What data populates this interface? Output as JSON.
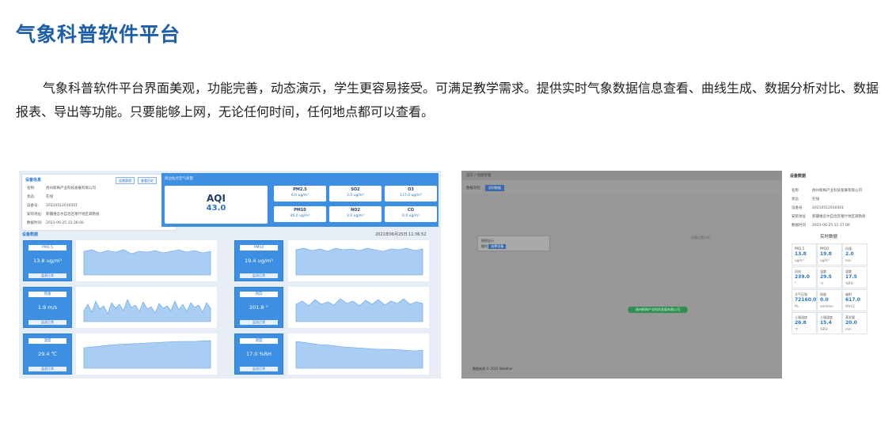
{
  "page": {
    "title": "气象科普软件平台",
    "intro": "气象科普软件平台界面美观，功能完善，动态演示，学生更容易接受。可满足教学需求。提供实时气象数据信息查看、曲线生成、数据分析对比、数据报表、导出等功能。只要能够上网，无论任何时间，任何地点都可以查看。"
  },
  "left_shot": {
    "device": {
      "header": "设备信息",
      "btn_manage": "运维管理",
      "btn_history": "查看历史",
      "rows": [
        {
          "k": "名称:",
          "v": "扬州新梅产业科技发展有限公司"
        },
        {
          "k": "状态:",
          "v": "在线"
        },
        {
          "k": "设备号:",
          "v": "20210512010301"
        },
        {
          "k": "安装地址:",
          "v": "新疆维吾尔自治区喀什地区疏勒县"
        },
        {
          "k": "数据时间:",
          "v": "2021-06-25 11:36:00"
        }
      ]
    },
    "aqi": {
      "header": "周边站点空气质量",
      "label": "AQI",
      "value": "43.0",
      "pollutants": [
        {
          "name": "PM2.5",
          "value": "6.0 ug/m³"
        },
        {
          "name": "SO2",
          "value": "3.0 ug/m³"
        },
        {
          "name": "O3",
          "value": "137.0 ug/m³"
        },
        {
          "name": "PM10",
          "value": "40.0 ug/m³"
        },
        {
          "name": "NO2",
          "value": "3.0 ug/m³"
        },
        {
          "name": "CO",
          "value": "0.4 ug/m³"
        }
      ]
    },
    "monitor": {
      "header": "设备数据",
      "datetime": "2021年06月25日 11:36:52",
      "status_label": "监测正常",
      "cards": [
        {
          "name": "PM2.5",
          "value": "13.8 ug/m³"
        },
        {
          "name": "PM10",
          "value": "19.4 ug/m³"
        },
        {
          "name": "风速",
          "value": "1.9 m/s"
        },
        {
          "name": "风向",
          "value": "201.8 °"
        },
        {
          "name": "温度",
          "value": "29.4 ℃"
        },
        {
          "name": "湿度",
          "value": "17.0 %RH"
        }
      ]
    }
  },
  "right_shot": {
    "topbar": "首页 / 地图管理",
    "tab_label": "数据对比",
    "tab_active": "实时数据",
    "legend_a": "图例显示",
    "legend_b": "操作",
    "legend_btn": "选择设备",
    "map_label": "设备位置分布",
    "green_button": "扬州新梅产业科技发展有限公司",
    "footnote": "数据来源 © 2021 Weather",
    "panel": {
      "header": "设备数据",
      "rows": [
        {
          "k": "名称",
          "v": "扬州新梅产业科技发展有限公司"
        },
        {
          "k": "状态",
          "v": "在线"
        },
        {
          "k": "设备号",
          "v": "20210512010301"
        },
        {
          "k": "安装地址",
          "v": "新疆维吾尔自治区喀什地区疏勒县"
        },
        {
          "k": "数据时间",
          "v": "2021-06-25 11:37:00"
        }
      ],
      "realtime_title": "实时数据",
      "cells": [
        {
          "n": "PM2.5",
          "v": "13.8",
          "u": "ug/m³"
        },
        {
          "n": "PM10",
          "v": "19.8",
          "u": "ug/m³"
        },
        {
          "n": "风速",
          "v": "2.0",
          "u": "m/s"
        },
        {
          "n": "风向",
          "v": "239.0",
          "u": "°"
        },
        {
          "n": "温度",
          "v": "29.5",
          "u": "℃"
        },
        {
          "n": "湿度",
          "v": "17.5",
          "u": "%RH"
        },
        {
          "n": "大气压强",
          "v": "72160.0",
          "u": "Pa"
        },
        {
          "n": "雨量",
          "v": "0.0",
          "u": "mm/min"
        },
        {
          "n": "辐射",
          "v": "617.0",
          "u": "W/m2"
        },
        {
          "n": "土壤温度",
          "v": "26.8",
          "u": "℃"
        },
        {
          "n": "土壤湿度",
          "v": "15.4",
          "u": "%RH"
        },
        {
          "n": "蒸发量",
          "v": "20.0",
          "u": "mm"
        }
      ]
    }
  },
  "colors": {
    "title": "#1d5ea8",
    "accent": "#3d8fe3",
    "panel_bg": "#e6edf5"
  }
}
